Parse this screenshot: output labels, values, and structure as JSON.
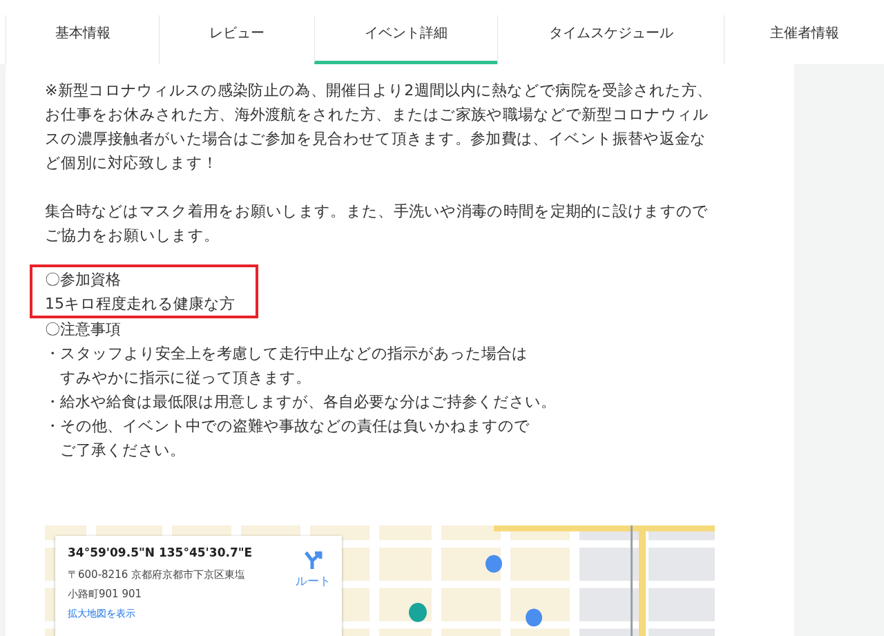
{
  "tabs": [
    {
      "label": "基本情報",
      "selected": false
    },
    {
      "label": "レビュー",
      "selected": false
    },
    {
      "label": "イベント詳細",
      "selected": true
    },
    {
      "label": "タイムスケジュール",
      "selected": false
    },
    {
      "label": "主催者情報",
      "selected": false
    }
  ],
  "paragraphs": [
    "※新型コロナウィルスの感染防止の為、開催日より2週間以内に熱などで病院を受診された方、お仕事をお休みされた方、海外渡航をされた方、またはご家族や職場などで新型コロナウィルスの濃厚接触者がいた場合はご参加を見合わせて頂きます。参加費は、イベント振替や返金など個別に対応致します！",
    "集合時などはマスク着用をお願いします。また、手洗いや消毒の時間を定期的に設けますのでご協力をお願いします。"
  ],
  "highlighted_block": {
    "lines": [
      "〇参加資格",
      "15キロ程度走れる健康な方"
    ]
  },
  "notes": {
    "heading": "〇注意事項",
    "items": [
      {
        "bullet": "・",
        "lines": [
          "スタッフより安全上を考慮して走行中止などの指示があった場合は",
          "すみやかに指示に従って頂きます。"
        ]
      },
      {
        "bullet": "・",
        "lines": [
          "給水や給食は最低限は用意しますが、各自必要な分はご持参ください。"
        ]
      },
      {
        "bullet": "・",
        "lines": [
          "その他、イベント中での盗難や事故などの責任は負いかねますので",
          "ご了承ください。"
        ]
      }
    ]
  },
  "map": {
    "kind": "picture",
    "info_card": {
      "coordinates": "34°59'09.5\"N 135°45'30.7\"E",
      "address_lines": [
        "〒600-8216 京都府京都市下京区東塩",
        "小路町901 901"
      ],
      "route_label": "ルート",
      "link": "拡大地図を表示"
    }
  }
}
